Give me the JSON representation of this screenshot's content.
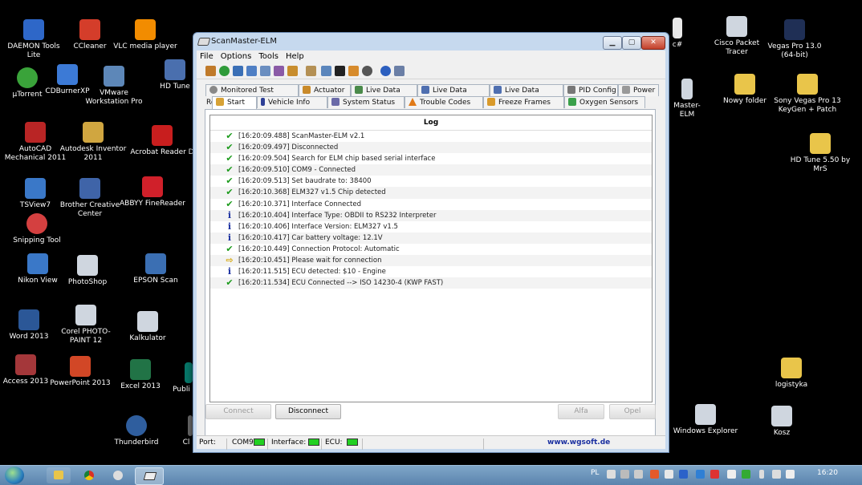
{
  "desktop": {
    "icons": [
      {
        "label": "DAEMON Tools Lite",
        "color": "#2e67c8"
      },
      {
        "label": "CCleaner",
        "color": "#d43d2a"
      },
      {
        "label": "VLC media player",
        "color": "#f28c00"
      },
      {
        "label": "µTorrent",
        "color": "#3aa33a"
      },
      {
        "label": "CDBurnerXP",
        "color": "#3c7ad6"
      },
      {
        "label": "VMware Workstation Pro",
        "color": "#5d87b8"
      },
      {
        "label": "HD Tune",
        "color": "#4a6fae"
      },
      {
        "label": "AutoCAD Mechanical 2011",
        "color": "#b92525"
      },
      {
        "label": "Autodesk Inventor 2011",
        "color": "#d0a640"
      },
      {
        "label": "Acrobat Reader D",
        "color": "#c81e1e"
      },
      {
        "label": "TSView7",
        "color": "#3a78c8"
      },
      {
        "label": "Brother Creative Center",
        "color": "#3f64a8"
      },
      {
        "label": "ABBYY FineReader",
        "color": "#d0202a"
      },
      {
        "label": "Snipping Tool",
        "color": "#d44040"
      },
      {
        "label": "Nikon View",
        "color": "#3a78c8"
      },
      {
        "label": "PhotoShop",
        "color": "#cfd6df"
      },
      {
        "label": "EPSON Scan",
        "color": "#3b6fb3"
      },
      {
        "label": "Word 2013",
        "color": "#2b5797"
      },
      {
        "label": "Corel PHOTO-PAINT 12",
        "color": "#cfd6df"
      },
      {
        "label": "Kalkulator",
        "color": "#cfd6df"
      },
      {
        "label": "Access 2013",
        "color": "#a4373a"
      },
      {
        "label": "PowerPoint 2013",
        "color": "#d24726"
      },
      {
        "label": "Excel 2013",
        "color": "#217346"
      },
      {
        "label": "Publi",
        "color": "#077568"
      },
      {
        "label": "Thunderbird",
        "color": "#2f5e9e"
      },
      {
        "label": "Cl",
        "color": "#666"
      },
      {
        "label": "c#",
        "color": "#e8e8e8"
      },
      {
        "label": "Cisco Packet Tracer",
        "color": "#cfd6df"
      },
      {
        "label": "Vegas Pro 13.0 (64-bit)",
        "color": "#1f2f55"
      },
      {
        "label": "Master-ELM",
        "color": "#cfd6df"
      },
      {
        "label": "Nowy folder",
        "color": "#e9c54a"
      },
      {
        "label": "Sony Vegas Pro 13 KeyGen + Patch",
        "color": "#e9c54a"
      },
      {
        "label": "HD Tune 5.50 by MrS",
        "color": "#e9c54a"
      },
      {
        "label": "logistyka",
        "color": "#e9c54a"
      },
      {
        "label": "Windows Explorer",
        "color": "#cfd6df"
      },
      {
        "label": "Kosz",
        "color": "#cfd6df"
      }
    ]
  },
  "window": {
    "title": "ScanMaster-ELM",
    "minimize": "▁",
    "maximize": "▢",
    "close": "✕",
    "menu": [
      "File",
      "Options",
      "Tools",
      "Help"
    ],
    "tabs_row1": [
      "Monitored Test Results",
      "Actuator",
      "Live Data Grid",
      "Live Data Meter",
      "Live Data Graph",
      "PID Config",
      "Power"
    ],
    "tabs_row2": [
      "Start",
      "Vehicle Info",
      "System Status",
      "Trouble Codes",
      "Freeze Frames",
      "Oxygen Sensors"
    ],
    "log_title": "Log",
    "log": [
      {
        "type": "ok",
        "text": "[16:20:09.488] ScanMaster-ELM v2.1"
      },
      {
        "type": "ok",
        "text": "[16:20:09.497] Disconnected"
      },
      {
        "type": "ok",
        "text": "[16:20:09.504] Search for ELM chip based serial interface"
      },
      {
        "type": "ok",
        "text": "[16:20:09.510] COM9 - Connected"
      },
      {
        "type": "ok",
        "text": "[16:20:09.513] Set baudrate to: 38400"
      },
      {
        "type": "ok",
        "text": "[16:20:10.368] ELM327 v1.5 Chip detected"
      },
      {
        "type": "ok",
        "text": "[16:20:10.371] Interface Connected"
      },
      {
        "type": "info",
        "text": "[16:20:10.404] Interface Type: OBDII to RS232 Interpreter"
      },
      {
        "type": "info",
        "text": "[16:20:10.406] Interface Version: ELM327 v1.5"
      },
      {
        "type": "info",
        "text": "[16:20:10.417] Car battery voltage: 12.1V"
      },
      {
        "type": "ok",
        "text": "[16:20:10.449] Connection Protocol: Automatic"
      },
      {
        "type": "wait",
        "text": "[16:20:10.451] Please wait for connection"
      },
      {
        "type": "info",
        "text": "[16:20:11.515] ECU detected: $10 - Engine"
      },
      {
        "type": "ok",
        "text": "[16:20:11.534] ECU Connected --> ISO 14230-4 (KWP FAST)"
      }
    ],
    "buttons": {
      "connect": "Connect",
      "disconnect": "Disconnect",
      "alfa": "Alfa",
      "opel": "Opel"
    },
    "status": {
      "port_label": "Port:",
      "port_value": "COM9",
      "interface_label": "Interface:",
      "ecu_label": "ECU:",
      "link": "www.wgsoft.de"
    }
  },
  "taskbar": {
    "lang": "PL",
    "time": "16:20"
  },
  "colors": {
    "ok": "#1a9a1a",
    "info": "#1a2fa0",
    "wait": "#d4a400",
    "led": "#22d022",
    "link": "#1a2fa0"
  }
}
